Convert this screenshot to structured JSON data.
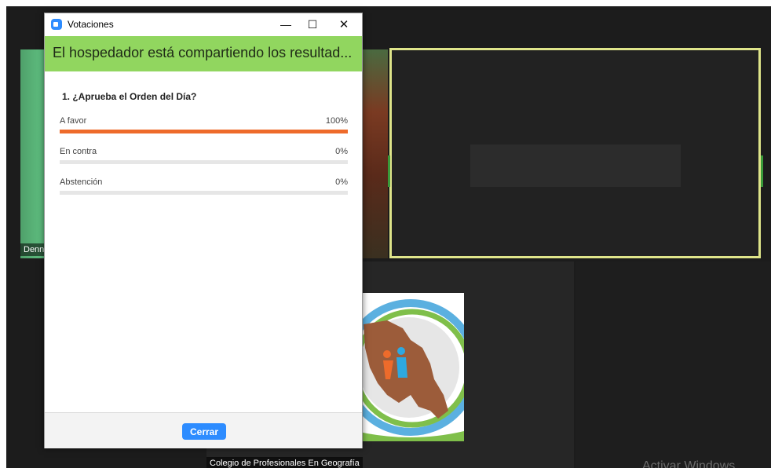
{
  "meeting": {
    "participant_name_label": "Denn",
    "bottom_tile_name": "Colegio de Profesionales En Geografía",
    "watermark": "Activar Windows"
  },
  "poll_window": {
    "title": "Votaciones",
    "controls": {
      "minimize": "—",
      "maximize": "☐",
      "close": "✕"
    },
    "banner": "El hospedador está compartiendo los resultados de la votación",
    "question": "1. ¿Aprueba el Orden del Día?",
    "options": [
      {
        "label": "A favor",
        "percent_text": "100%",
        "percent": 100
      },
      {
        "label": "En contra",
        "percent_text": "0%",
        "percent": 0
      },
      {
        "label": "Abstención",
        "percent_text": "0%",
        "percent": 0
      }
    ],
    "close_button": "Cerrar"
  },
  "colors": {
    "banner": "#91d65f",
    "bar_fill": "#ee6b2b",
    "button": "#2d8cff",
    "active_speaker_border": "#dfe58a"
  },
  "icons": [
    "zoom-app-icon",
    "minimize-icon",
    "maximize-icon",
    "close-icon",
    "geography-logo"
  ]
}
